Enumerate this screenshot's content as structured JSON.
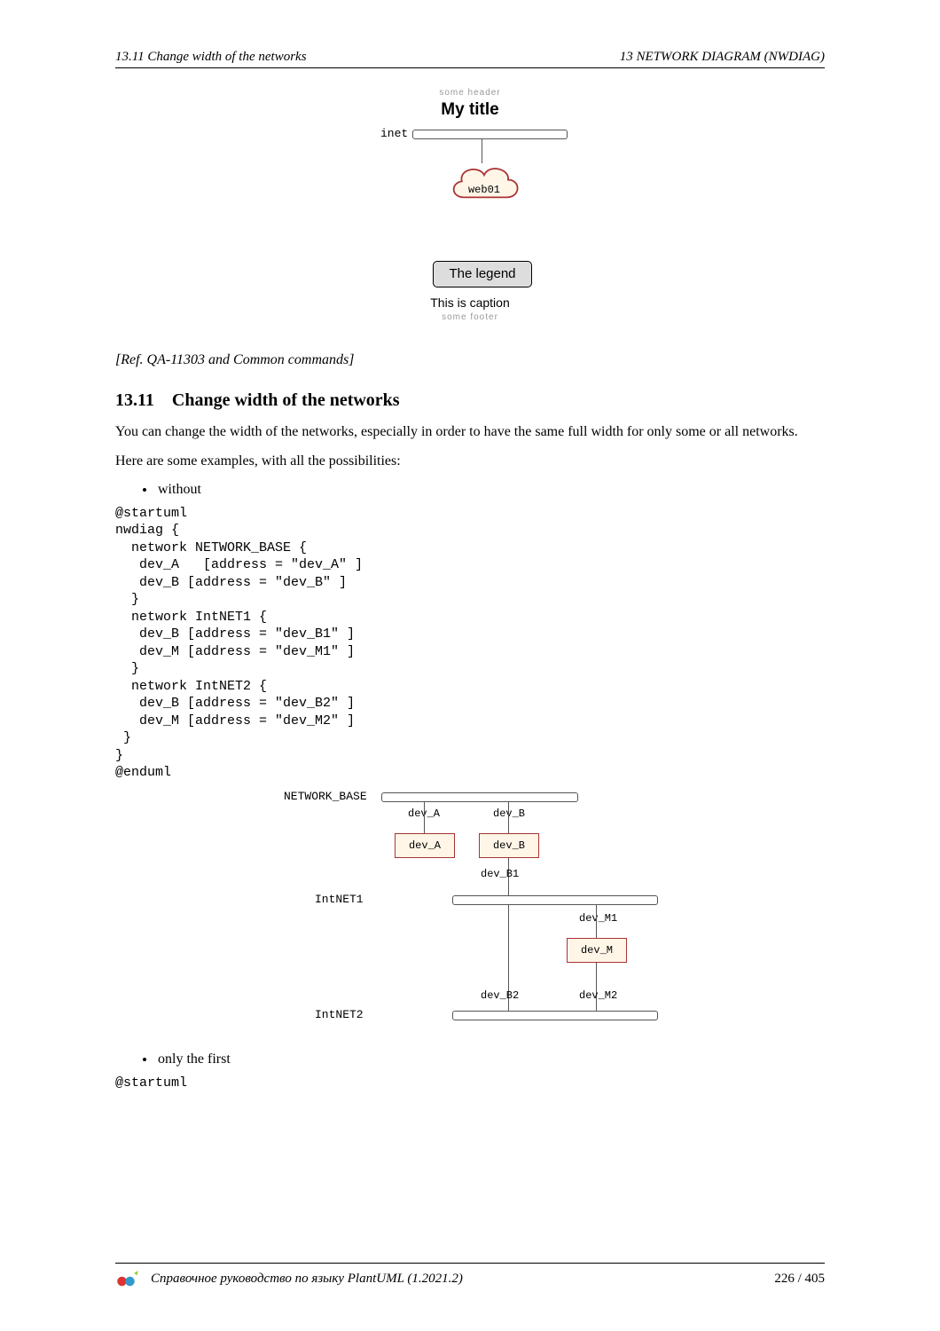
{
  "runhead": {
    "left": "13.11    Change width of the networks",
    "right": "13    NETWORK DIAGRAM (NWDIAG)"
  },
  "diagram1": {
    "header": "some header",
    "title": "My title",
    "net_label": "inet",
    "cloud_label": "web01",
    "legend": "The legend",
    "caption": "This is caption",
    "footer": "some footer"
  },
  "ref_note": "[Ref. QA-11303 and Common commands]",
  "section": {
    "number": "13.11",
    "title": "Change width of the networks",
    "para1": "You can change the width of the networks, especially in order to have the same full width for only some or all networks.",
    "para2": "Here are some examples, with all the possibilities:"
  },
  "bullets": {
    "without": "without",
    "only_first": "only the first"
  },
  "code_block_1": "@startuml\nnwdiag {\n  network NETWORK_BASE {\n   dev_A   [address = \"dev_A\" ]\n   dev_B [address = \"dev_B\" ]\n  }\n  network IntNET1 {\n   dev_B [address = \"dev_B1\" ]\n   dev_M [address = \"dev_M1\" ]\n  }\n  network IntNET2 {\n   dev_B [address = \"dev_B2\" ]\n   dev_M [address = \"dev_M2\" ]\n }\n}\n@enduml",
  "code_block_2": "@startuml",
  "diagram2": {
    "networks": {
      "base": "NETWORK_BASE",
      "n1": "IntNET1",
      "n2": "IntNET2"
    },
    "nodes": {
      "dev_A": "dev_A",
      "dev_B": "dev_B",
      "dev_M": "dev_M"
    },
    "addresses": {
      "dev_A": "dev_A",
      "dev_B": "dev_B",
      "dev_B1": "dev_B1",
      "dev_M1": "dev_M1",
      "dev_B2": "dev_B2",
      "dev_M2": "dev_M2"
    }
  },
  "footer": {
    "title": "Справочное руководство по языку PlantUML (1.2021.2)",
    "page": "226 / 405"
  },
  "chart_data": [
    {
      "type": "diagram",
      "description": "nwdiag with header/title/cloud/legend/caption/footer",
      "header": "some header",
      "title": "My title",
      "legend": "The legend",
      "caption": "This is caption",
      "footer": "some footer",
      "networks": [
        {
          "name": "inet",
          "nodes": [
            "web01"
          ]
        }
      ]
    },
    {
      "type": "diagram",
      "description": "nwdiag three networks with addressed nodes",
      "networks": [
        {
          "name": "NETWORK_BASE",
          "nodes": [
            {
              "name": "dev_A",
              "address": "dev_A"
            },
            {
              "name": "dev_B",
              "address": "dev_B"
            }
          ]
        },
        {
          "name": "IntNET1",
          "nodes": [
            {
              "name": "dev_B",
              "address": "dev_B1"
            },
            {
              "name": "dev_M",
              "address": "dev_M1"
            }
          ]
        },
        {
          "name": "IntNET2",
          "nodes": [
            {
              "name": "dev_B",
              "address": "dev_B2"
            },
            {
              "name": "dev_M",
              "address": "dev_M2"
            }
          ]
        }
      ]
    }
  ]
}
